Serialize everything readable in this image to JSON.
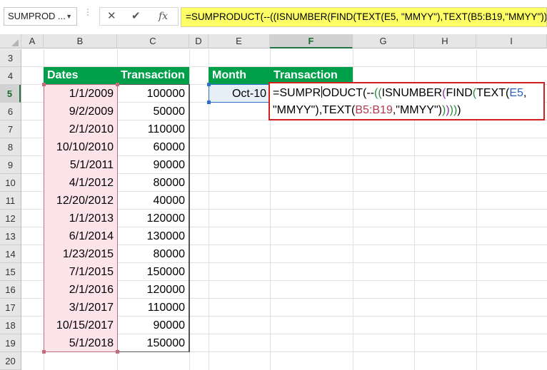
{
  "formula_bar": {
    "name_box": "SUMPROD ...",
    "cancel_icon": "✕",
    "enter_icon": "✔",
    "fx_label": "fx",
    "formula": "=SUMPRODUCT(--((ISNUMBER(FIND(TEXT(E5, \"MMYY\"),TEXT(B5:B19,\"MMYY\"))))))"
  },
  "columns": [
    "A",
    "B",
    "C",
    "D",
    "E",
    "F",
    "G",
    "H",
    "I"
  ],
  "rows": [
    "3",
    "4",
    "5",
    "6",
    "7",
    "8",
    "9",
    "10",
    "11",
    "12",
    "13",
    "14",
    "15",
    "16",
    "17",
    "18",
    "19",
    "20"
  ],
  "active_cell": {
    "column": "F",
    "row": "5"
  },
  "table": {
    "headers": {
      "dates": "Dates",
      "transaction": "Transaction"
    },
    "records": [
      {
        "date": "1/1/2009",
        "amount": "100000"
      },
      {
        "date": "9/2/2009",
        "amount": "50000"
      },
      {
        "date": "2/1/2010",
        "amount": "110000"
      },
      {
        "date": "10/10/2010",
        "amount": "60000"
      },
      {
        "date": "5/1/2011",
        "amount": "90000"
      },
      {
        "date": "4/1/2012",
        "amount": "80000"
      },
      {
        "date": "12/20/2012",
        "amount": "40000"
      },
      {
        "date": "1/1/2013",
        "amount": "120000"
      },
      {
        "date": "6/1/2014",
        "amount": "130000"
      },
      {
        "date": "1/23/2015",
        "amount": "80000"
      },
      {
        "date": "7/1/2015",
        "amount": "150000"
      },
      {
        "date": "2/1/2016",
        "amount": "120000"
      },
      {
        "date": "3/1/2017",
        "amount": "110000"
      },
      {
        "date": "10/15/2017",
        "amount": "90000"
      },
      {
        "date": "5/1/2018",
        "amount": "150000"
      }
    ]
  },
  "lookup": {
    "headers": {
      "month": "Month",
      "transaction": "Transaction"
    },
    "month_value": "Oct-10"
  },
  "edit_formula": {
    "t1": "=SUMPR",
    "t2": "ODUCT(--",
    "t3": "((",
    "t4": "ISNUMBER",
    "t5": "(",
    "t6": "FIND",
    "t7": "(",
    "t8": "TEXT(",
    "t9": "E5",
    "t10": ",",
    "t11": "\"MMYY\"),TEXT(",
    "t12": "B5:B19",
    "t13": ",\"MMYY\"",
    "t14": ")",
    "t15": ")",
    "t16": ")",
    "t17": "))",
    "t18": ")"
  },
  "colors": {
    "header_green": "#00a04a",
    "formula_highlight": "#ffff66",
    "edit_border": "#d21f1f",
    "range_fill": "#fce4ea"
  }
}
